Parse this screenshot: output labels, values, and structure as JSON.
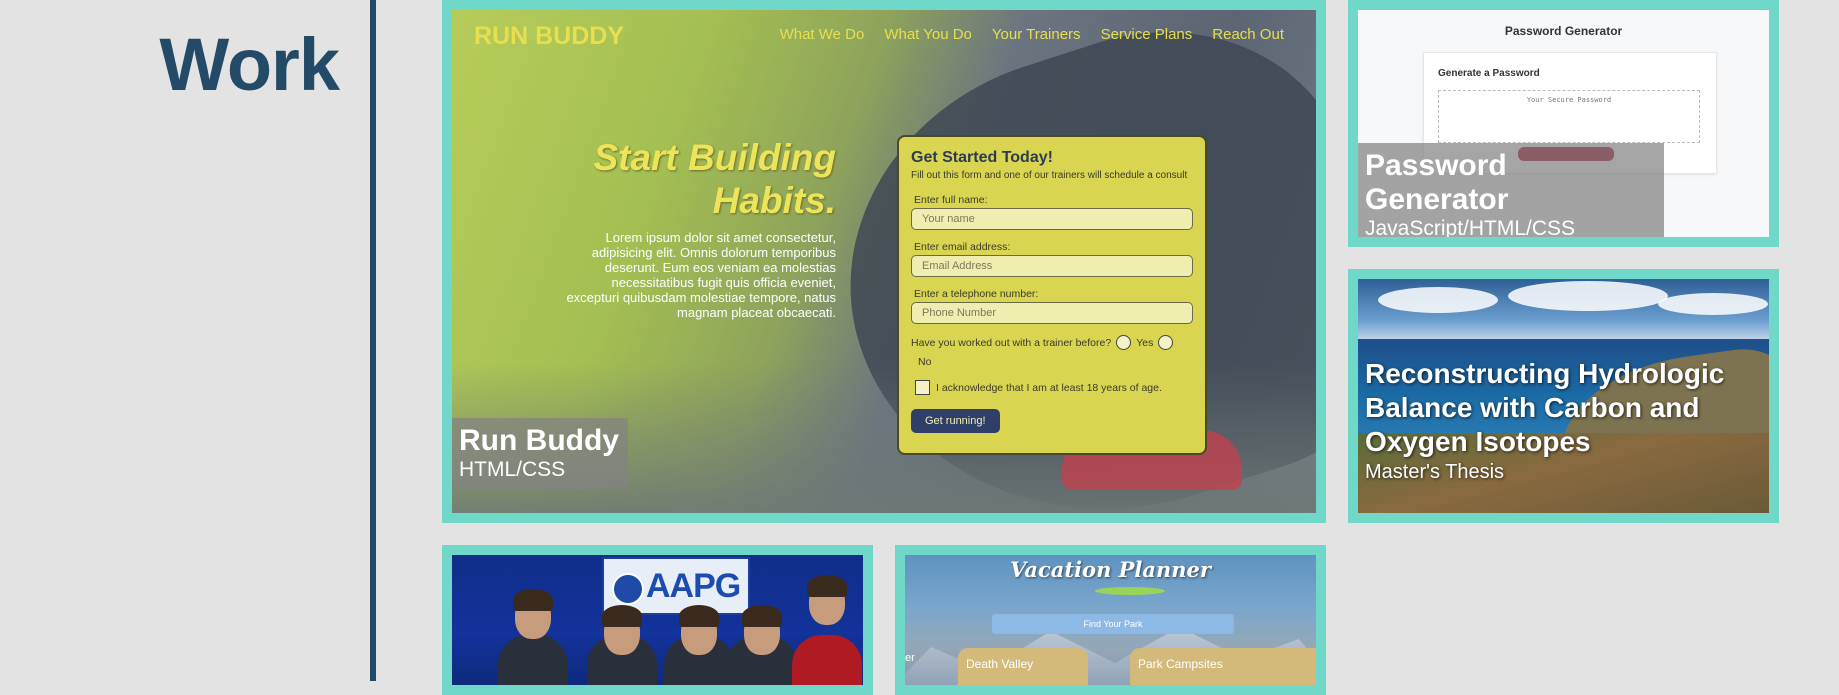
{
  "section": {
    "heading": "Work"
  },
  "projects": {
    "run_buddy": {
      "title": "Run Buddy",
      "subtitle": "HTML/CSS",
      "screenshot": {
        "logo": "RUN BUDDY",
        "nav": [
          "What We Do",
          "What You Do",
          "Your Trainers",
          "Service Plans",
          "Reach Out"
        ],
        "hero_title_line1": "Start Building",
        "hero_title_line2": "Habits.",
        "hero_text": "Lorem ipsum dolor sit amet consectetur, adipisicing elit. Omnis dolorum temporibus deserunt. Eum eos veniam ea molestias necessitatibus fugit quis officia eveniet, excepturi quibusdam molestiae tempore, natus magnam placeat obcaecati.",
        "form": {
          "title": "Get Started Today!",
          "subtitle": "Fill out this form and one of our trainers will schedule a consult",
          "name_label": "Enter full name:",
          "name_placeholder": "Your name",
          "email_label": "Enter email address:",
          "email_placeholder": "Email Address",
          "phone_label": "Enter a telephone number:",
          "phone_placeholder": "Phone Number",
          "trainer_question": "Have you worked out with a trainer before?",
          "yes_label": "Yes",
          "no_label": "No",
          "acknowledge_label": "I acknowledge that I am at least 18 years of age.",
          "submit_label": "Get running!"
        }
      }
    },
    "password_generator": {
      "title": "Password Generator",
      "subtitle": "JavaScript/HTML/CSS",
      "screenshot": {
        "page_title": "Password Generator",
        "card_heading": "Generate a Password",
        "placeholder": "Your Secure Password"
      }
    },
    "thesis": {
      "title": "Reconstructing Hydrologic Balance with Carbon and Oxygen Isotopes",
      "subtitle": "Master's Thesis"
    },
    "aapg": {
      "screenshot": {
        "sign_text": "AAPG"
      }
    },
    "vacation_planner": {
      "screenshot": {
        "title": "Vacation Planner",
        "search_button": "Find Your Park",
        "partial_text": "er",
        "parks": [
          "Death Valley",
          "Park Campsites"
        ]
      }
    }
  },
  "colors": {
    "accent": "#6fd8c8",
    "heading": "#234a66",
    "background": "#e3e3e3"
  }
}
